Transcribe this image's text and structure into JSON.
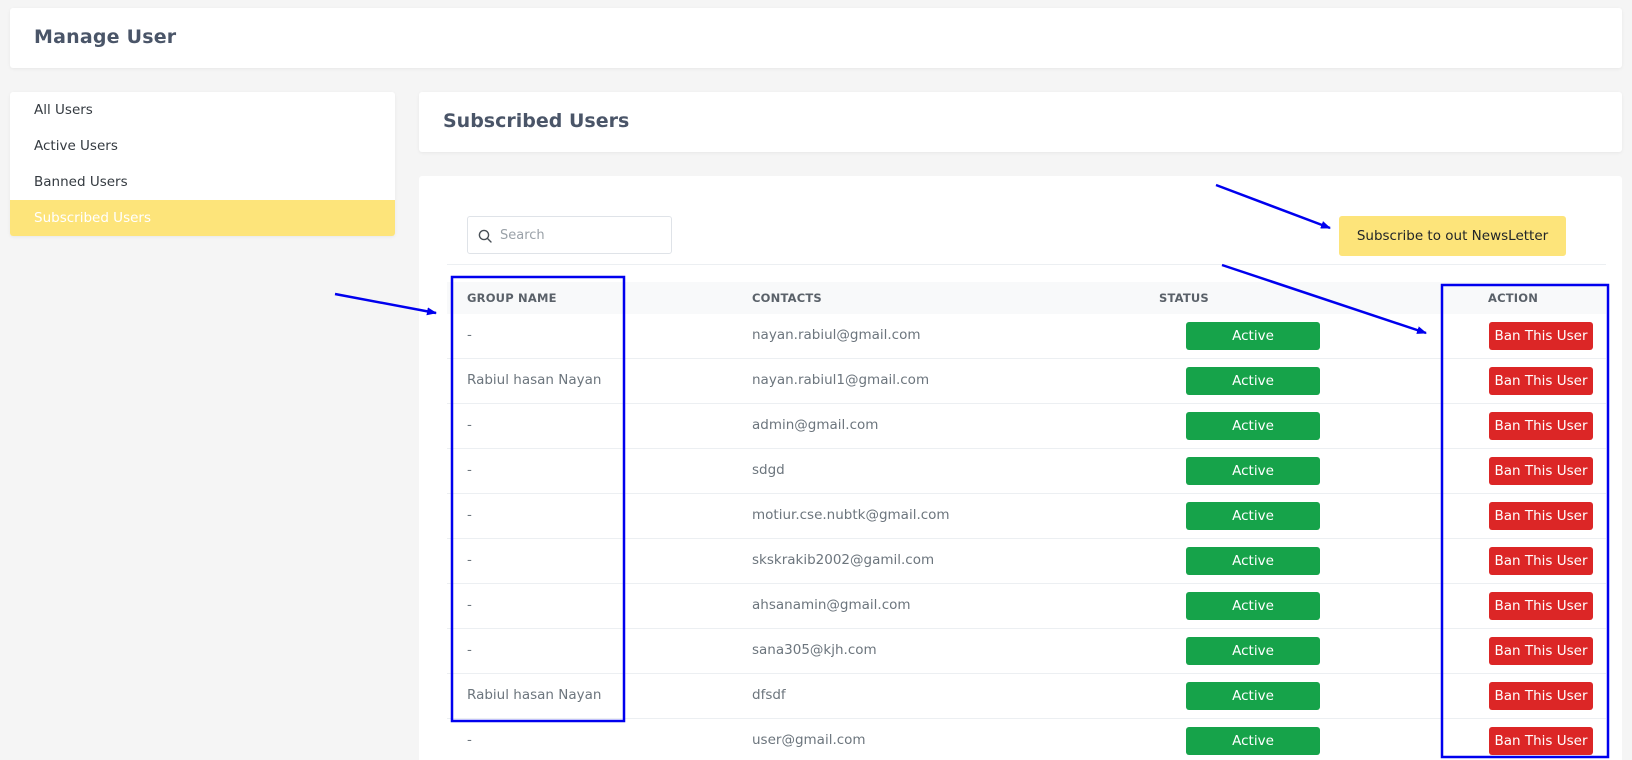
{
  "header": {
    "title": "Manage User"
  },
  "sidebar": {
    "items": [
      {
        "label": "All Users"
      },
      {
        "label": "Active Users"
      },
      {
        "label": "Banned Users"
      },
      {
        "label": "Subscribed Users"
      }
    ],
    "active_index": 3
  },
  "main": {
    "title": "Subscribed Users",
    "search": {
      "placeholder": "Search",
      "value": ""
    },
    "newsletter_button": "Subscribe to out NewsLetter",
    "table": {
      "columns": [
        "GROUP NAME",
        "CONTACTS",
        "STATUS",
        "ACTION"
      ],
      "rows": [
        {
          "group": "-",
          "contact": "nayan.rabiul@gmail.com",
          "status": "Active",
          "action": "Ban This User"
        },
        {
          "group": "Rabiul hasan Nayan",
          "contact": "nayan.rabiul1@gmail.com",
          "status": "Active",
          "action": "Ban This User"
        },
        {
          "group": "-",
          "contact": "admin@gmail.com",
          "status": "Active",
          "action": "Ban This User"
        },
        {
          "group": "-",
          "contact": "sdgd",
          "status": "Active",
          "action": "Ban This User"
        },
        {
          "group": "-",
          "contact": "motiur.cse.nubtk@gmail.com",
          "status": "Active",
          "action": "Ban This User"
        },
        {
          "group": "-",
          "contact": "skskrakib2002@gamil.com",
          "status": "Active",
          "action": "Ban This User"
        },
        {
          "group": "-",
          "contact": "ahsanamin@gmail.com",
          "status": "Active",
          "action": "Ban This User"
        },
        {
          "group": "-",
          "contact": "sana305@kjh.com",
          "status": "Active",
          "action": "Ban This User"
        },
        {
          "group": "Rabiul hasan Nayan",
          "contact": "dfsdf",
          "status": "Active",
          "action": "Ban This User"
        },
        {
          "group": "-",
          "contact": "user@gmail.com",
          "status": "Active",
          "action": "Ban This User"
        }
      ]
    }
  },
  "colors": {
    "accent_yellow": "#fde47a",
    "status_green": "#16a34a",
    "danger_red": "#dc2626",
    "annotation_blue": "#0000ee"
  }
}
